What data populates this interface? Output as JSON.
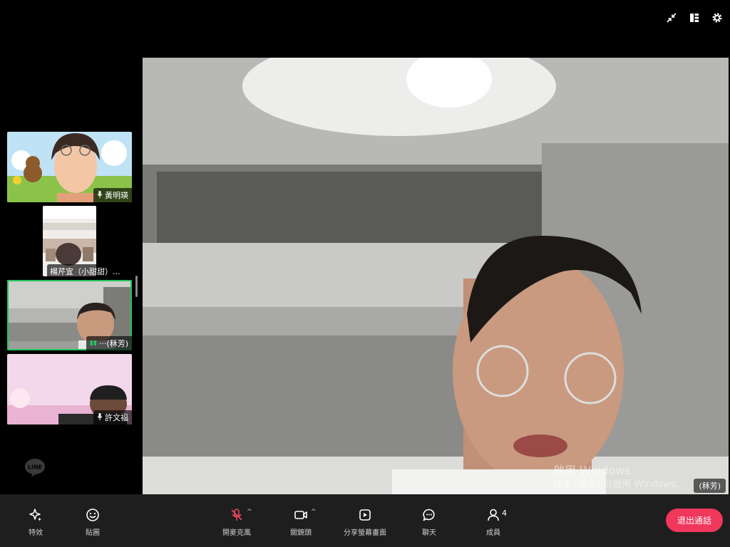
{
  "top_icons": [
    "minimize-icon",
    "layout-icon",
    "settings-icon"
  ],
  "participants": [
    {
      "name": "黃明瑛",
      "mic": "mic-icon"
    },
    {
      "name": "楊芹宜（小甜甜）...",
      "mic": ""
    },
    {
      "name": "···(秝芳)",
      "mic": "",
      "speaking": true
    },
    {
      "name": "許文福",
      "mic": "mic-icon"
    }
  ],
  "main_video": {
    "name": "(秝芳)",
    "watermark_line1": "啟用 Windows",
    "watermark_line2": "移至 [設定] 以啟用 Windows。"
  },
  "logo": "LINE",
  "controls": {
    "effects": "特效",
    "stickers": "貼圖",
    "mic": "開麥克風",
    "camera": "關鏡頭",
    "share": "分享螢幕畫面",
    "chat": "聊天",
    "members": "成員",
    "member_count": "4"
  },
  "leave_label": "退出通話",
  "colors": {
    "accent": "#f0375c",
    "active_border": "#22c55e",
    "mic_off": "#e5475c"
  }
}
